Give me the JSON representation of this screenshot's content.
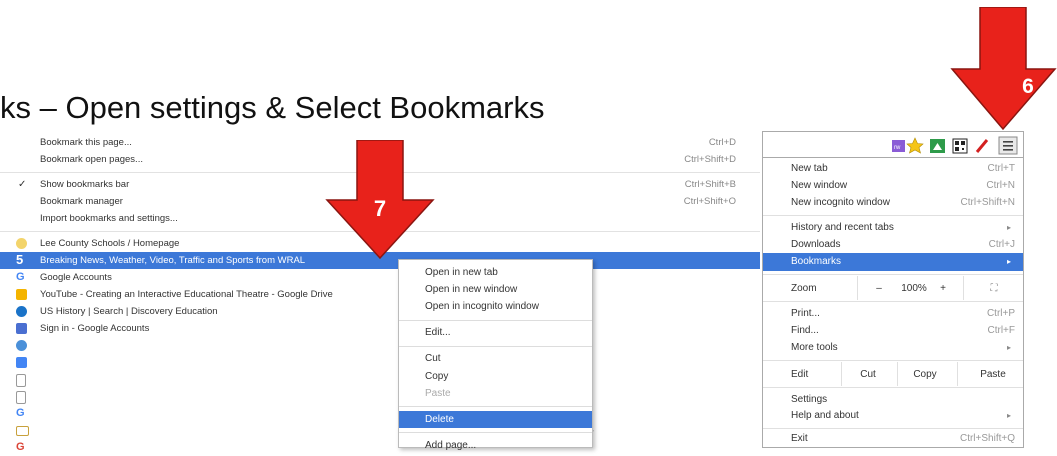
{
  "title": "ks – Open settings & Select Bookmarks",
  "arrows": {
    "step7": "7",
    "step6": "6"
  },
  "colors": {
    "arrow_red": "#e8221b",
    "highlight_blue": "#3c78d8"
  },
  "bookmarks_menu": {
    "top_items": [
      {
        "label": "Bookmark this page...",
        "shortcut": "Ctrl+D"
      },
      {
        "label": "Bookmark open pages...",
        "shortcut": "Ctrl+Shift+D"
      }
    ],
    "mid_items": [
      {
        "label": "Show bookmarks bar",
        "shortcut": "Ctrl+Shift+B",
        "checked": "✓"
      },
      {
        "label": "Bookmark manager",
        "shortcut": "Ctrl+Shift+O"
      },
      {
        "label": "Import bookmarks and settings...",
        "shortcut": ""
      }
    ],
    "bookmarks": [
      {
        "label": "Lee County Schools / Homepage",
        "icon": "lee-county-favicon-icon"
      },
      {
        "label": "Breaking News, Weather, Video, Traffic and Sports from WRAL",
        "icon": "wral-5-icon"
      },
      {
        "label": "Google Accounts",
        "icon": "google-g-icon"
      },
      {
        "label": "YouTube - Creating an Interactive Educational Theatre - Google Drive",
        "icon": "google-slides-icon"
      },
      {
        "label": "US History | Search | Discovery Education",
        "icon": "discovery-education-icon"
      },
      {
        "label": "Sign in - Google Accounts",
        "icon": "google-plus-icon"
      }
    ],
    "icon_only_rows": [
      "chrome-icon",
      "google-docs-icon",
      "page-icon",
      "page-icon",
      "google-g-icon",
      "folder-icon",
      "google-g-icon"
    ]
  },
  "context_menu": {
    "items": [
      {
        "label": "Open in new tab"
      },
      {
        "label": "Open in new window"
      },
      {
        "label": "Open in incognito window"
      },
      {
        "label": "Edit..."
      },
      {
        "label": "Cut"
      },
      {
        "label": "Copy"
      },
      {
        "label": "Paste"
      },
      {
        "label": "Delete"
      },
      {
        "label": "Add page..."
      }
    ]
  },
  "chrome_menu": {
    "toolbar_icons": [
      "extension-puzzle-icon",
      "bookmark-star-icon",
      "drive-icon",
      "qr-code-icon",
      "pen-icon",
      "hamburger-menu-icon"
    ],
    "items": {
      "new_tab": {
        "label": "New tab",
        "shortcut": "Ctrl+T"
      },
      "new_window": {
        "label": "New window",
        "shortcut": "Ctrl+N"
      },
      "new_incognito": {
        "label": "New incognito window",
        "shortcut": "Ctrl+Shift+N"
      },
      "history": {
        "label": "History and recent tabs"
      },
      "downloads": {
        "label": "Downloads",
        "shortcut": "Ctrl+J"
      },
      "bookmarks": {
        "label": "Bookmarks"
      },
      "zoom": {
        "label": "Zoom",
        "minus": "–",
        "value": "100%",
        "plus": "+"
      },
      "print": {
        "label": "Print...",
        "shortcut": "Ctrl+P"
      },
      "find": {
        "label": "Find...",
        "shortcut": "Ctrl+F"
      },
      "more_tools": {
        "label": "More tools"
      },
      "edit": {
        "label": "Edit",
        "cut": "Cut",
        "copy": "Copy",
        "paste": "Paste"
      },
      "settings": {
        "label": "Settings"
      },
      "help": {
        "label": "Help and about"
      },
      "exit": {
        "label": "Exit",
        "shortcut": "Ctrl+Shift+Q"
      }
    }
  }
}
